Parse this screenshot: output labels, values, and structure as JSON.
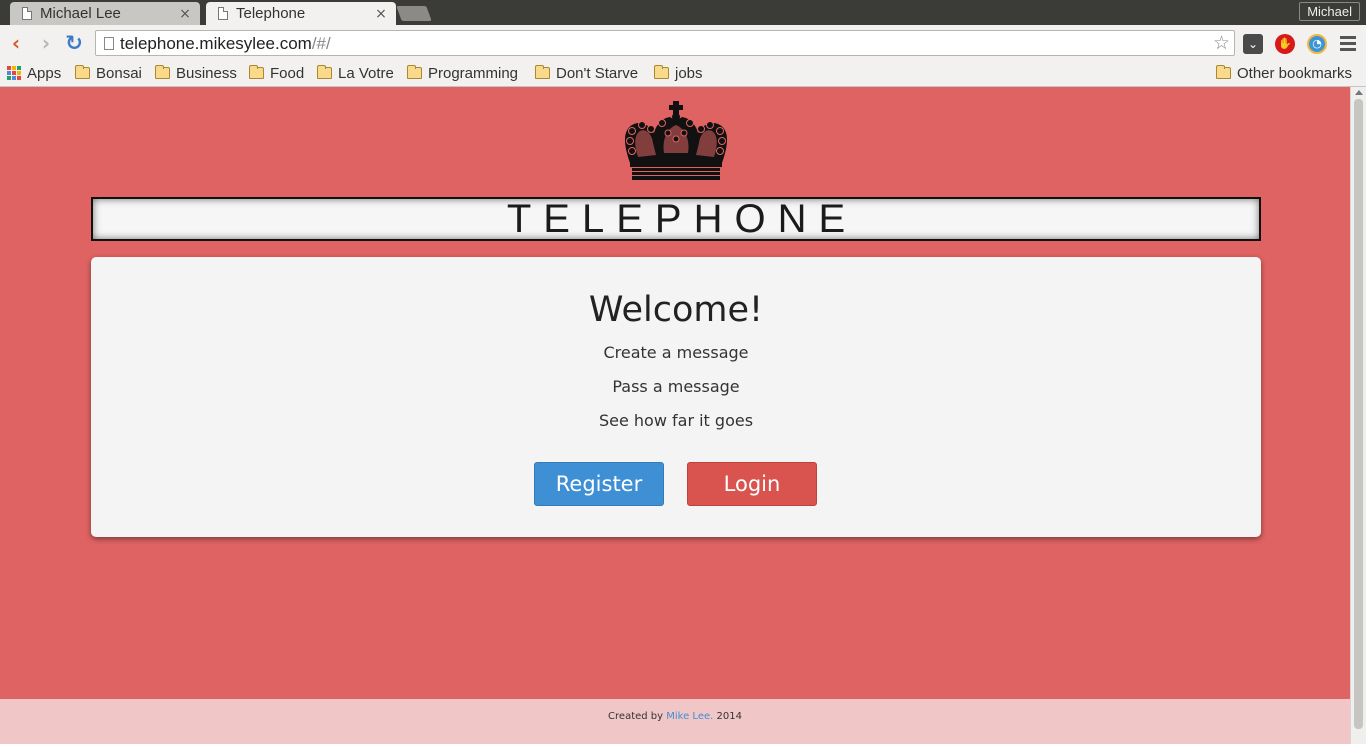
{
  "browser": {
    "tabs": [
      {
        "title": "Michael Lee",
        "close": "×",
        "active": false
      },
      {
        "title": "Telephone",
        "close": "×",
        "active": true
      }
    ],
    "profile_name": "Michael",
    "url_host": "telephone.mikesylee.com",
    "url_path": "/#/",
    "bookmarks": {
      "apps": "Apps",
      "folders": [
        "Bonsai",
        "Business",
        "Food",
        "La Votre",
        "Programming",
        "Don't Starve",
        "jobs"
      ],
      "other": "Other bookmarks"
    }
  },
  "page": {
    "title": "TELEPHONE",
    "welcome": "Welcome!",
    "lines": [
      "Create a message",
      "Pass a message",
      "See how far it goes"
    ],
    "register_label": "Register",
    "login_label": "Login",
    "footer": {
      "prefix": "Created by ",
      "link": "Mike Lee.",
      "suffix": " 2014"
    }
  },
  "colors": {
    "background": "#e06363",
    "card": "#f4f4f4",
    "register": "#3e8fd4",
    "login": "#d9534f",
    "footer": "#f1c6c6"
  }
}
